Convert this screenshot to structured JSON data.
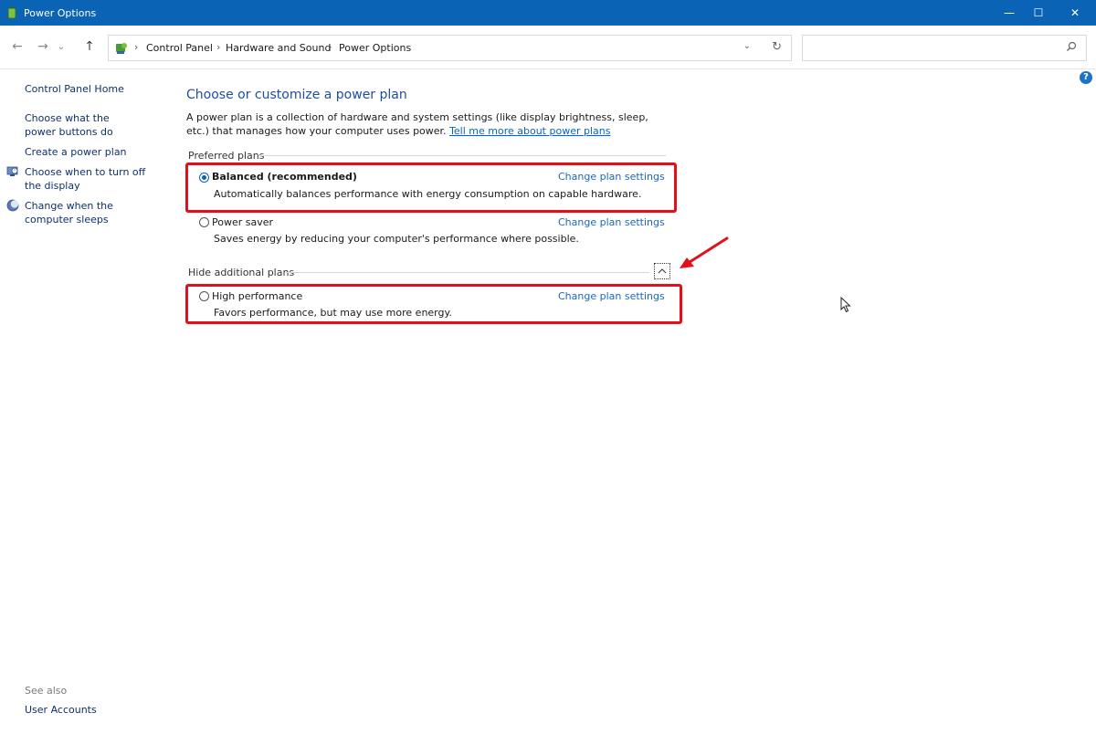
{
  "window": {
    "title": "Power Options",
    "minimize": "—",
    "maximize": "☐",
    "close": "✕"
  },
  "nav": {
    "back": "←",
    "forward": "→",
    "recent": "⌄",
    "up": "↑"
  },
  "address": {
    "crumbs": [
      "Control Panel",
      "Hardware and Sound",
      "Power Options"
    ],
    "separator": "›",
    "dropdown": "⌄",
    "refresh": "↻"
  },
  "search": {
    "placeholder": "",
    "value": ""
  },
  "help": "?",
  "sidebar": {
    "home": "Control Panel Home",
    "items": [
      {
        "label": "Choose what the power buttons do"
      },
      {
        "label": "Create a power plan"
      },
      {
        "label": "Choose when to turn off the display",
        "icon": "monitor-clock-icon"
      },
      {
        "label": "Change when the computer sleeps",
        "icon": "moon-icon"
      }
    ],
    "see_also": "See also",
    "user_accounts": "User Accounts"
  },
  "main": {
    "title": "Choose or customize a power plan",
    "intro": "A power plan is a collection of hardware and system settings (like display brightness, sleep, etc.) that manages how your computer uses power.",
    "intro_link": "Tell me more about power plans",
    "preferred_heading": "Preferred plans",
    "additional_heading": "Hide additional plans",
    "collapse_glyph": "^",
    "plans": [
      {
        "name": "Balanced (recommended)",
        "desc": "Automatically balances performance with energy consumption on capable hardware.",
        "link": "Change plan settings",
        "selected": true
      },
      {
        "name": "Power saver",
        "desc": "Saves energy by reducing your computer's performance where possible.",
        "link": "Change plan settings",
        "selected": false
      },
      {
        "name": "High performance",
        "desc": "Favors performance, but may use more energy.",
        "link": "Change plan settings",
        "selected": false
      }
    ]
  },
  "colors": {
    "titlebar": "#0a63b5",
    "highlight": "#e3101a",
    "link": "#1a66c5"
  }
}
